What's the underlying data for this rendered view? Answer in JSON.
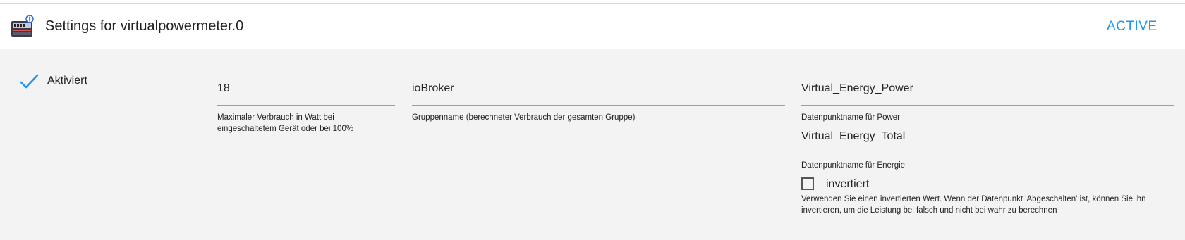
{
  "header": {
    "title": "Settings for virtualpowermeter.0",
    "status": "ACTIVE",
    "logo_icon": "virtualpowermeter-logo-icon",
    "accent_color": "#2196f3"
  },
  "activated": {
    "label": "Aktiviert",
    "checked": true,
    "icon": "checkmark-icon"
  },
  "fields": {
    "max_power": {
      "value": "18",
      "help": "Maximaler Verbrauch in Watt bei eingeschaltetem Gerät oder bei 100%"
    },
    "group_name": {
      "value": "ioBroker",
      "help": "Gruppenname (berechneter Verbrauch der gesamten Gruppe)"
    },
    "power_datapoint": {
      "value": "Virtual_Energy_Power",
      "help": "Datenpunktname für Power"
    },
    "energy_datapoint": {
      "value": "Virtual_Energy_Total",
      "help": "Datenpunktname für Energie"
    }
  },
  "inverted": {
    "label": "invertiert",
    "checked": false,
    "help": "Verwenden Sie einen invertierten Wert. Wenn der Datenpunkt 'Abgeschalten' ist, können Sie ihn invertieren, um die Leistung bei falsch und nicht bei wahr zu berechnen"
  }
}
